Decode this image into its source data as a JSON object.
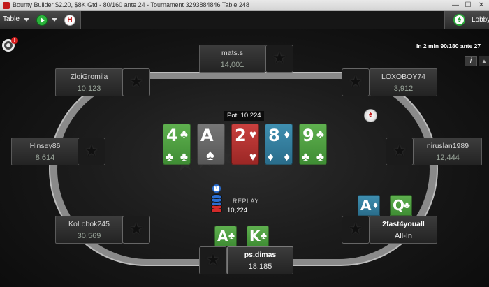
{
  "window": {
    "title": "Bounty Builder $2.20, $8K Gtd - 80/160 ante 24 - Tournament 3293884846 Table 248",
    "minimize": "—",
    "maximize": "☐",
    "close": "✕"
  },
  "toolbar": {
    "table_label": "Table",
    "rebuy_label": "H",
    "lobby_label": "Lobby"
  },
  "info": {
    "blinds_text": "In 2 min 90/180 ante 27",
    "info_label": "i",
    "scroll_up": "▲",
    "alert_count": "!"
  },
  "pot": {
    "label": "Pot: 10,224"
  },
  "board": [
    {
      "rank": "4",
      "suit": "♣",
      "color": "#4f9f42"
    },
    {
      "rank": "A",
      "suit": "♠",
      "color": "#676767"
    },
    {
      "rank": "2",
      "suit": "♥",
      "color": "#b33230"
    },
    {
      "rank": "8",
      "suit": "♦",
      "color": "#357e9e"
    },
    {
      "rank": "9",
      "suit": "♣",
      "color": "#4f9f42"
    }
  ],
  "players": {
    "top": {
      "name": "mats.s",
      "stack": "14,001"
    },
    "top_left": {
      "name": "ZloiGromila",
      "stack": "10,123"
    },
    "top_right": {
      "name": "LOXOBOY74",
      "stack": "3,912"
    },
    "left": {
      "name": "Hinsey86",
      "stack": "8,614"
    },
    "right": {
      "name": "niruslan1989",
      "stack": "12,444"
    },
    "bottom_left": {
      "name": "KoLobok245",
      "stack": "30,569"
    },
    "hero": {
      "name": "ps.dimas",
      "stack": "18,185",
      "cards": [
        {
          "rank": "A",
          "suit": "♣"
        },
        {
          "rank": "K",
          "suit": "♣"
        }
      ]
    },
    "villain_allin": {
      "name": "2fast4youall",
      "status": "All-In",
      "cards": [
        {
          "rank": "A",
          "suit": "♦"
        },
        {
          "rank": "Q",
          "suit": "♣"
        }
      ]
    }
  },
  "bet": {
    "chip_label": "1",
    "amount": "10,224",
    "replay_label": "REPLAY"
  },
  "colors": {
    "clubs": "#4f9f42",
    "spades": "#676767",
    "hearts": "#b33230",
    "diamonds": "#357e9e",
    "stack_text": "#9aa59a",
    "accent_green": "#2bb33c"
  },
  "icons": [
    "pokerstars-logo-icon",
    "play-icon",
    "rebuy-h-icon",
    "lobby-icon",
    "target-icon",
    "info-icon",
    "dealer-button-icon",
    "chip-stack-icon",
    "avatar-star-icon"
  ]
}
